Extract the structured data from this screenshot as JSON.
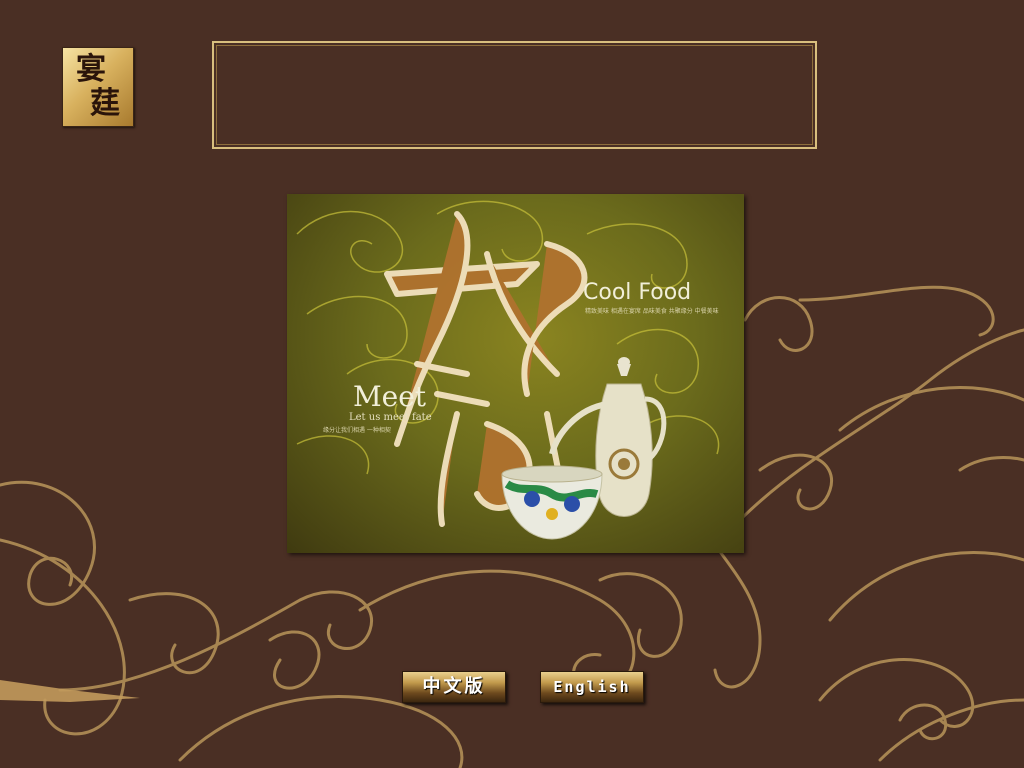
{
  "logo": {
    "char1": "宴",
    "char2": "莛"
  },
  "banner": {
    "text": ""
  },
  "poster": {
    "title": "Cool Food",
    "title_subtext": "精致美味 相遇在宴席 品味美食 共聚缘分 中餐美味",
    "meet": "Meet",
    "meet_sub": "Let us meet fate",
    "meet_sub2": "缘分让我们相遇 一种相契"
  },
  "languages": {
    "chinese_label": "中文版",
    "english_label": "English"
  },
  "colors": {
    "background": "#4a2f24",
    "gold": "#d9bf7e",
    "swirl": "#b8955a"
  }
}
